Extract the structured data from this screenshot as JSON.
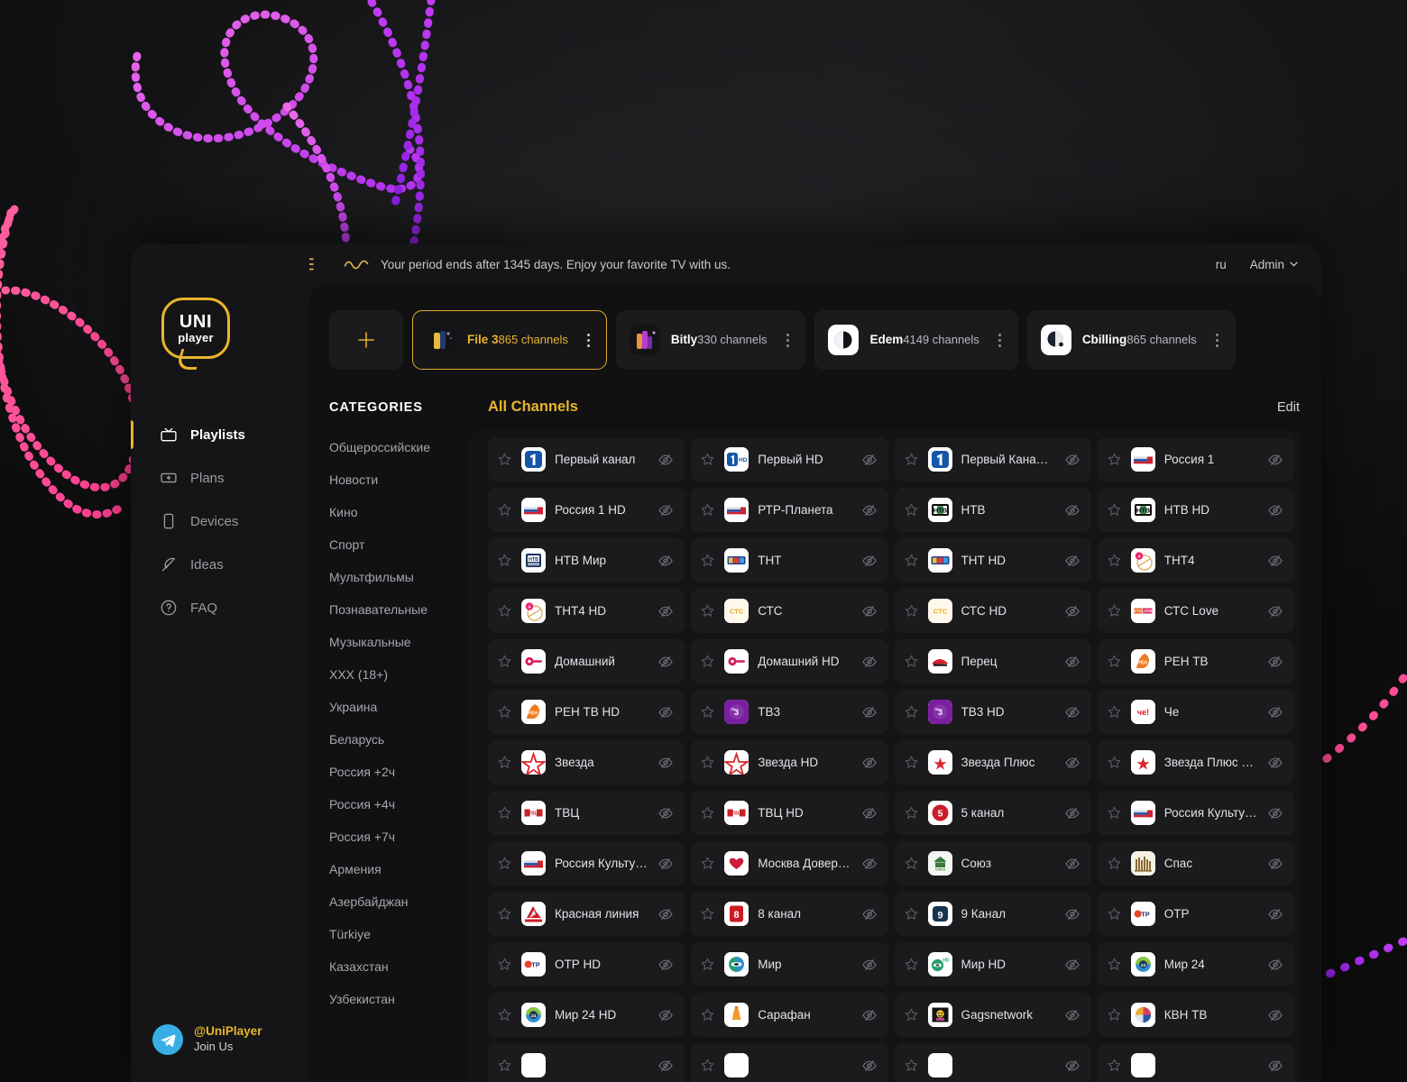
{
  "brand": {
    "name_top": "UNI",
    "name_bottom": "player"
  },
  "topbar": {
    "collapse_icon": "collapse-sidebar-icon",
    "wave_icon": "wave-icon",
    "notice": "Your period ends after 1345 days. Enjoy your favorite TV with us.",
    "language": "ru",
    "account": "Admin",
    "chevron": "˅"
  },
  "sidebar": {
    "items": [
      {
        "label": "Playlists",
        "icon": "tv-icon",
        "active": true
      },
      {
        "label": "Plans",
        "icon": "plans-card-icon",
        "active": false
      },
      {
        "label": "Devices",
        "icon": "device-phone-icon",
        "active": false
      },
      {
        "label": "Ideas",
        "icon": "feather-icon",
        "active": false
      },
      {
        "label": "FAQ",
        "icon": "question-circle-icon",
        "active": false
      }
    ],
    "telegram": {
      "icon": "telegram-icon",
      "handle": "@UniPlayer",
      "cta": "Join Us"
    }
  },
  "playlists": {
    "add_label": "+",
    "items": [
      {
        "name": "File 3",
        "count": "865 channels",
        "selected": true,
        "thumb": "file3"
      },
      {
        "name": "Bitly",
        "count": "330 channels",
        "selected": false,
        "thumb": "bitly"
      },
      {
        "name": "Edem",
        "count": "4149 channels",
        "selected": false,
        "thumb": "edem"
      },
      {
        "name": "Cbilling",
        "count": "865 channels",
        "selected": false,
        "thumb": "cbilling"
      }
    ]
  },
  "categories": {
    "title": "CATEGORIES",
    "items": [
      "Общероссийские",
      "Новости",
      "Кино",
      "Спорт",
      "Мультфильмы",
      "Познавательные",
      "Музыкальные",
      "XXX (18+)",
      "Украина",
      "Беларусь",
      "Россия +2ч",
      "Россия +4ч",
      "Россия +7ч",
      "Армения",
      "Азербайджан",
      "Türkiye",
      "Казахстан",
      "Узбекистан"
    ]
  },
  "channels": {
    "title": "All Channels",
    "edit_label": "Edit",
    "star_icon": "star-outline-icon",
    "eye_icon": "eye-hidden-icon",
    "items": [
      {
        "name": "Первый канал",
        "logo": "perviy"
      },
      {
        "name": "Первый HD",
        "logo": "perviyhd"
      },
      {
        "name": "Первый Канал …",
        "logo": "perviy"
      },
      {
        "name": "Россия 1",
        "logo": "rossiya"
      },
      {
        "name": "Россия 1 HD",
        "logo": "rossiya"
      },
      {
        "name": "РТР-Планета",
        "logo": "rossiya"
      },
      {
        "name": "НТВ",
        "logo": "ntv"
      },
      {
        "name": "НТВ HD",
        "logo": "ntv"
      },
      {
        "name": "НТВ Мир",
        "logo": "ntvmir"
      },
      {
        "name": "ТНТ",
        "logo": "tnt"
      },
      {
        "name": "ТНТ HD",
        "logo": "tnt"
      },
      {
        "name": "ТНТ4",
        "logo": "tnt4"
      },
      {
        "name": "ТНТ4 HD",
        "logo": "tnt4"
      },
      {
        "name": "СТС",
        "logo": "sts"
      },
      {
        "name": "СТС HD",
        "logo": "sts"
      },
      {
        "name": "СТС Love",
        "logo": "stslove"
      },
      {
        "name": "Домашний",
        "logo": "domashniy"
      },
      {
        "name": "Домашний HD",
        "logo": "domashniy"
      },
      {
        "name": "Перец",
        "logo": "perec"
      },
      {
        "name": "РЕН ТВ",
        "logo": "ren"
      },
      {
        "name": "РЕН ТВ HD",
        "logo": "ren"
      },
      {
        "name": "ТВ3",
        "logo": "tv3"
      },
      {
        "name": "ТВ3 HD",
        "logo": "tv3"
      },
      {
        "name": "Че",
        "logo": "che"
      },
      {
        "name": "Звезда",
        "logo": "zvezda"
      },
      {
        "name": "Звезда HD",
        "logo": "zvezda"
      },
      {
        "name": "Звезда Плюс",
        "logo": "zvezdaplus"
      },
      {
        "name": "Звезда Плюс Н…",
        "logo": "zvezdaplus"
      },
      {
        "name": "ТВЦ",
        "logo": "tvc"
      },
      {
        "name": "ТВЦ HD",
        "logo": "tvc"
      },
      {
        "name": "5 канал",
        "logo": "five"
      },
      {
        "name": "Россия Культу…",
        "logo": "rossiya"
      },
      {
        "name": "Россия Культу…",
        "logo": "rossiya"
      },
      {
        "name": "Москва Довер…",
        "logo": "moskva"
      },
      {
        "name": "Союз",
        "logo": "soyuz"
      },
      {
        "name": "Спас",
        "logo": "spas"
      },
      {
        "name": "Красная линия",
        "logo": "krasnaya"
      },
      {
        "name": "8 канал",
        "logo": "eight"
      },
      {
        "name": "9 Канал",
        "logo": "nine"
      },
      {
        "name": "ОТР",
        "logo": "otr"
      },
      {
        "name": "ОТР HD",
        "logo": "otr"
      },
      {
        "name": "Мир",
        "logo": "mir"
      },
      {
        "name": "Мир HD",
        "logo": "mirhd"
      },
      {
        "name": "Мир 24",
        "logo": "mir24"
      },
      {
        "name": "Мир 24 HD",
        "logo": "mir24"
      },
      {
        "name": "Сарафан",
        "logo": "sarafan"
      },
      {
        "name": "Gagsnetwork",
        "logo": "gags"
      },
      {
        "name": "КВН ТВ",
        "logo": "kvn"
      },
      {
        "name": "",
        "logo": "blank"
      },
      {
        "name": "",
        "logo": "blank"
      },
      {
        "name": "",
        "logo": "blank"
      },
      {
        "name": "",
        "logo": "blank"
      }
    ]
  },
  "colors": {
    "accent": "#e9b52c",
    "background": "#0d0d0e",
    "panel": "#151517",
    "card": "#1b1b1e",
    "text": "#e3e3e7",
    "muted": "#a6a6ac",
    "deco_pink": "#f4449e",
    "deco_magenta": "#e04ce0",
    "deco_purple": "#a22ff0",
    "telegram": "#38aee5"
  }
}
